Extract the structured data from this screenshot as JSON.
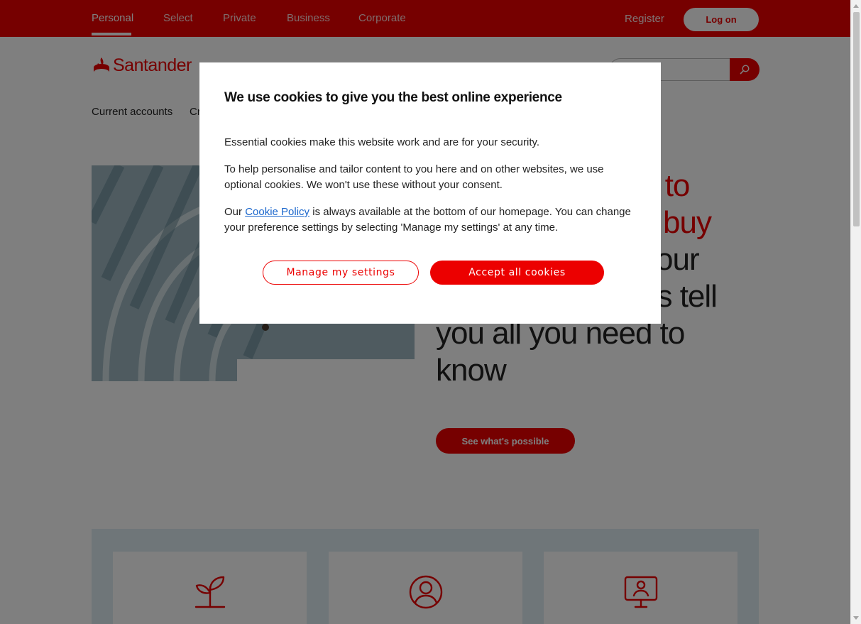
{
  "topnav": {
    "items": [
      "Personal",
      "Select",
      "Private",
      "Business",
      "Corporate"
    ],
    "register": "Register",
    "logon": "Log on"
  },
  "brand": {
    "name": "Santander",
    "color": "#ec0000"
  },
  "search": {
    "icon": "search-icon"
  },
  "subnav": {
    "items": [
      "Current accounts",
      "Cr"
    ]
  },
  "hero": {
    "title_red": "g to",
    "title_red2": "buy",
    "title_dark1": "our",
    "title_dark2": "es tell",
    "title_dark3": "you all you need to",
    "title_dark4": "know",
    "cta": "See what's possible"
  },
  "features": {
    "icons": [
      "seedling-icon",
      "user-circle-icon",
      "monitor-person-icon"
    ]
  },
  "cookie_modal": {
    "title": "We use cookies to give you the best online experience",
    "p1": "Essential cookies make this website work and are for your security.",
    "p2": "To help personalise and tailor content to you here and on other websites, we use optional cookies. We won't use these without your consent.",
    "p3_prefix": "Our ",
    "p3_link": "Cookie Policy",
    "p3_suffix": " is always available at the bottom of our homepage. You can change your preference settings by selecting 'Manage my settings' at any time.",
    "manage": "Manage my settings",
    "accept": "Accept all cookies"
  }
}
